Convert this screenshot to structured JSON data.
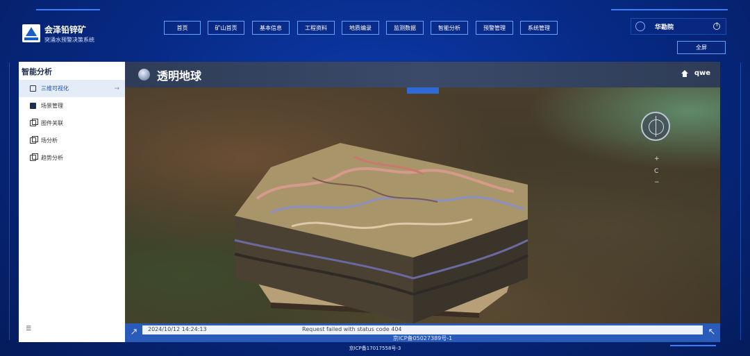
{
  "brand": {
    "title": "会泽铅锌矿",
    "subtitle": "突涌水预警决策系统"
  },
  "nav": {
    "items": [
      {
        "label": "首页"
      },
      {
        "label": "矿山首页"
      },
      {
        "label": "基本信息"
      },
      {
        "label": "工程资料"
      },
      {
        "label": "地质编录"
      },
      {
        "label": "监测数据"
      },
      {
        "label": "智能分析"
      },
      {
        "label": "预警管理"
      },
      {
        "label": "系统管理"
      }
    ]
  },
  "user": {
    "name": "华勘院",
    "fullscreen_label": "全屏",
    "header_user": "qwe"
  },
  "sidebar": {
    "title": "智能分析",
    "items": [
      {
        "label": "三维可视化",
        "icon": "cube-outline-icon",
        "active": true
      },
      {
        "label": "场景管理",
        "icon": "scene-icon",
        "active": false
      },
      {
        "label": "图件关联",
        "icon": "copy-icon",
        "active": false
      },
      {
        "label": "场分析",
        "icon": "copy-icon",
        "active": false
      },
      {
        "label": "趋势分析",
        "icon": "copy-icon",
        "active": false
      }
    ],
    "arrow": "→",
    "collapse_icon": "☰"
  },
  "main": {
    "title": "透明地球",
    "zoom_plus": "+",
    "zoom_reset": "C",
    "zoom_minus": "−"
  },
  "status": {
    "time": "2024/10/12 14:24:13",
    "message": "Request failed with status code 404",
    "icp_1": "京ICP备05027389号-1",
    "icp_3": "京ICP备17017558号-3"
  },
  "colors": {
    "page_bg": "#06206a",
    "accent": "#2e6ad6",
    "header_bar": "#2e3c57"
  }
}
